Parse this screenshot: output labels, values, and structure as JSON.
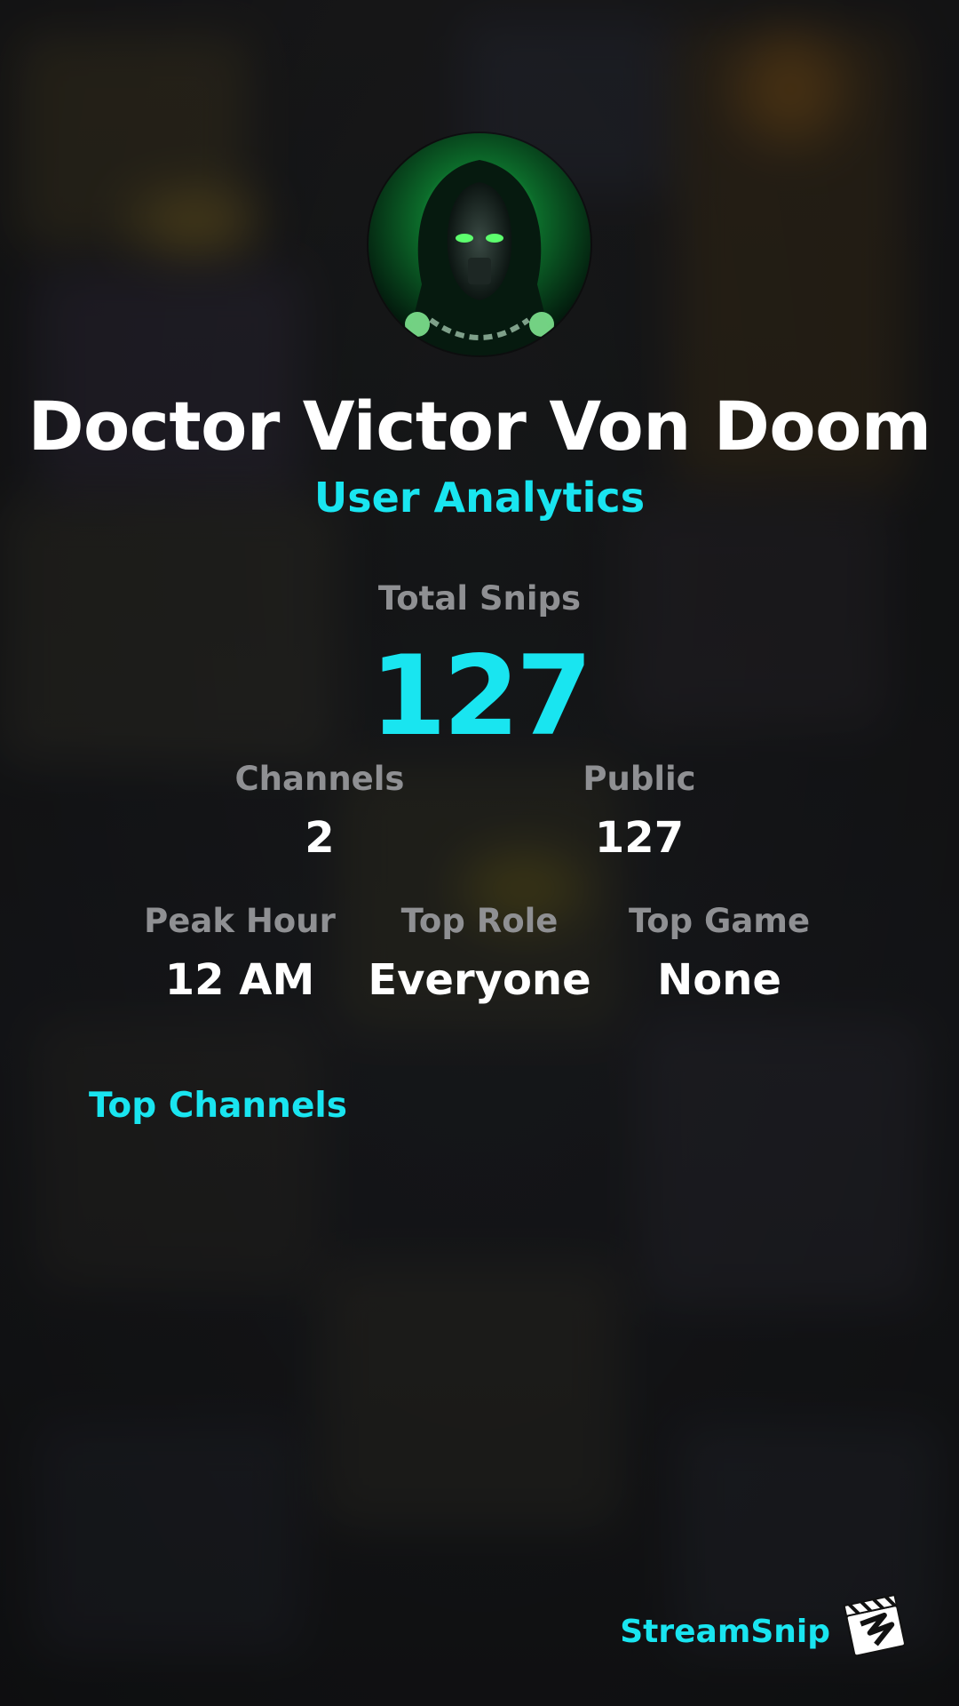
{
  "profile": {
    "display_name": "Doctor Victor Von Doom",
    "subtitle": "User Analytics",
    "avatar_icon": "hooded-masked-figure-avatar"
  },
  "stats": {
    "total_snips_label": "Total Snips",
    "total_snips_value": "127",
    "channels_label": "Channels",
    "channels_value": "2",
    "public_label": "Public",
    "public_value": "127",
    "peak_hour_label": "Peak Hour",
    "peak_hour_value": "12 AM",
    "top_role_label": "Top Role",
    "top_role_value": "Everyone",
    "top_game_label": "Top Game",
    "top_game_value": "None"
  },
  "sections": {
    "top_channels_heading": "Top Channels"
  },
  "branding": {
    "name": "StreamSnip",
    "logo_icon": "clapperboard-icon"
  },
  "colors": {
    "accent": "#19e5f0",
    "label": "#8f9093",
    "value": "#ffffff",
    "background": "#1d1f22"
  }
}
